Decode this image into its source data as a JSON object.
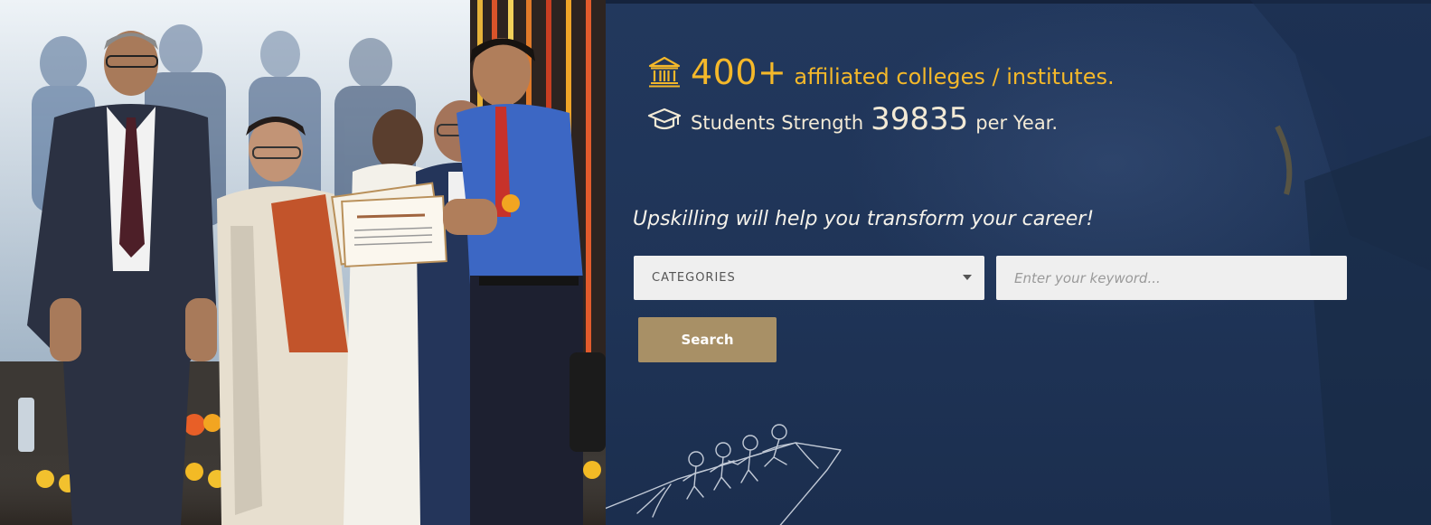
{
  "stats": {
    "colleges": {
      "icon": "institution-icon",
      "number": "400+",
      "text": "affiliated colleges / institutes."
    },
    "students": {
      "icon": "graduation-cap-icon",
      "prefix": "Students Strength",
      "number": "39835",
      "suffix": "per Year."
    }
  },
  "tagline": "Upskilling will help you transform your career!",
  "search": {
    "category_label": "CATEGORIES",
    "keyword_placeholder": "Enter your keyword...",
    "keyword_value": "",
    "button_label": "Search"
  },
  "colors": {
    "panel_bg": "#1f355a",
    "gold": "#f4b82a",
    "cream": "#f3ead6",
    "button": "#a89066",
    "field": "#efefef"
  }
}
